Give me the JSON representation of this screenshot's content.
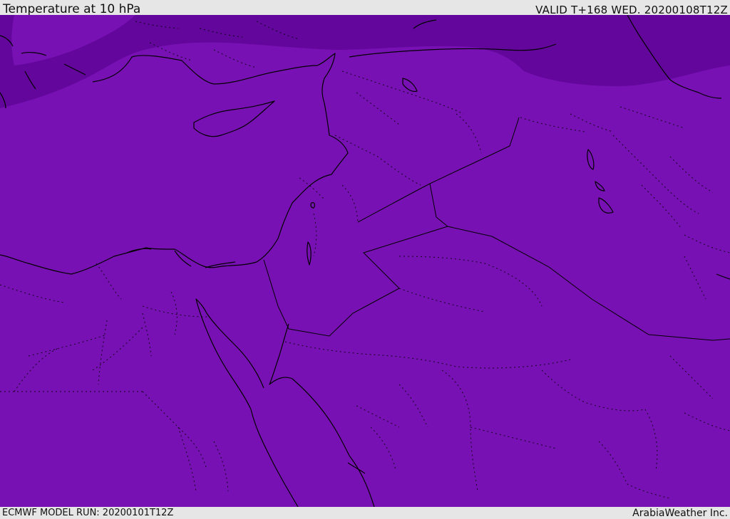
{
  "header": {
    "title": "Temperature at 10 hPa",
    "valid": "VALID T+168 WED. 20200108T12Z"
  },
  "footer": {
    "model_run": "ECMWF MODEL RUN: 20200101T12Z",
    "credit": "ArabiaWeather Inc."
  },
  "colors": {
    "field_main": "#7811b3",
    "field_cold": "#63069c",
    "coastline": "#000000",
    "border": "#000000",
    "bars": "#e6e6e6"
  }
}
